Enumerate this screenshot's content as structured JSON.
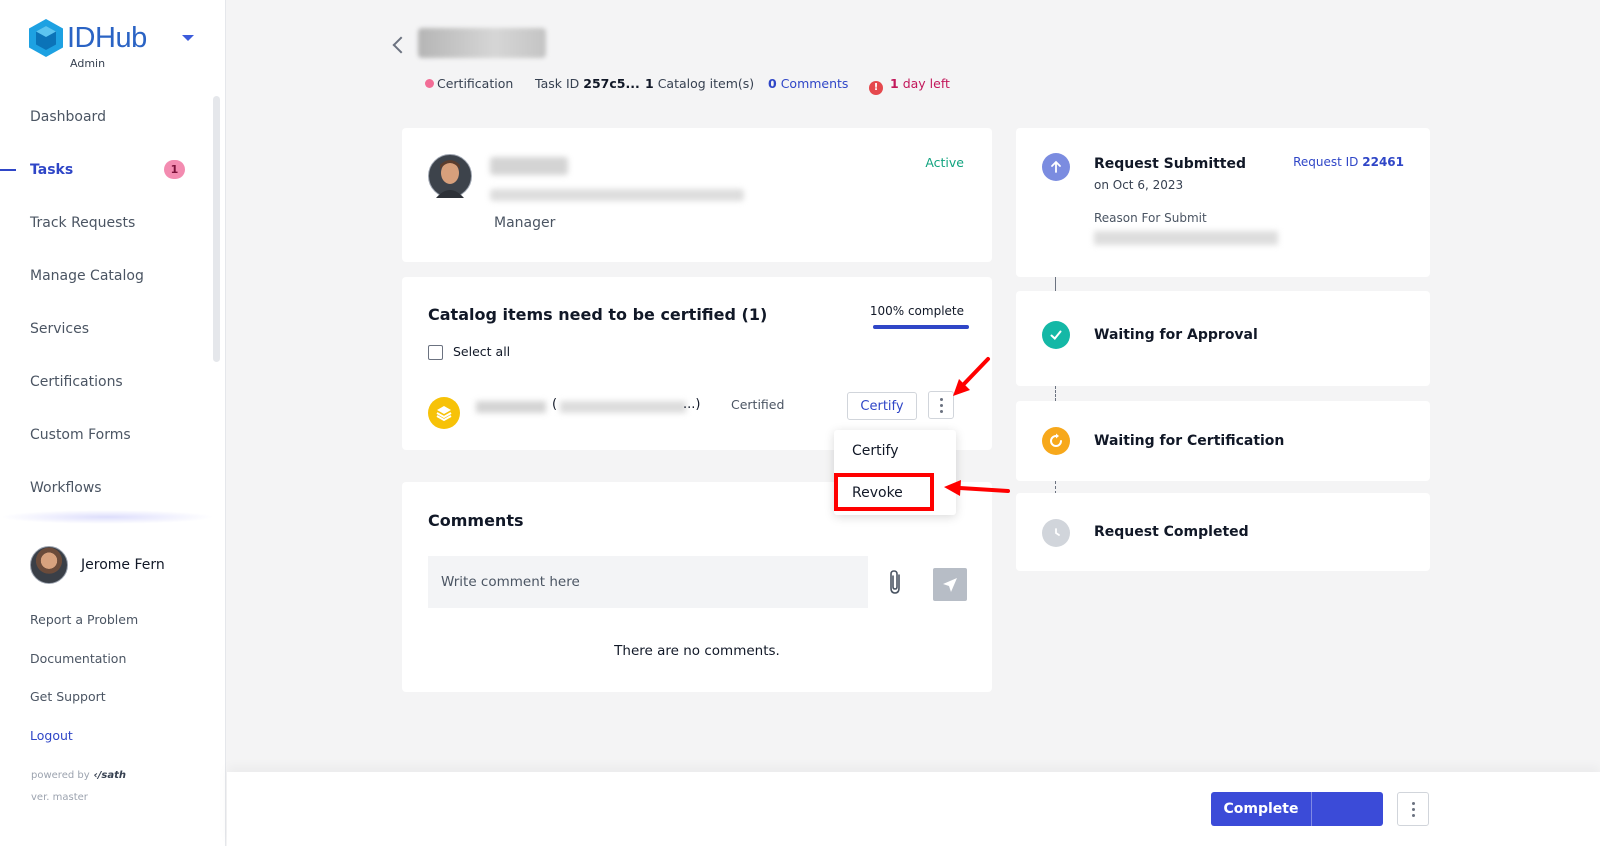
{
  "brand": {
    "name": "IDHub",
    "subtitle": "Admin"
  },
  "sidebar": {
    "items": [
      {
        "label": "Dashboard"
      },
      {
        "label": "Tasks",
        "badge": "1",
        "active": true
      },
      {
        "label": "Track Requests"
      },
      {
        "label": "Manage Catalog"
      },
      {
        "label": "Services"
      },
      {
        "label": "Certifications"
      },
      {
        "label": "Custom Forms"
      },
      {
        "label": "Workflows"
      }
    ],
    "user": {
      "name": "Jerome Fern"
    },
    "links": [
      "Report a Problem",
      "Documentation",
      "Get Support",
      "Logout"
    ],
    "powered_by": "powered by",
    "powered_brand": "‹/sath",
    "version": "ver. master"
  },
  "header": {
    "type": "Certification",
    "task_id_label": "Task ID",
    "task_id_value": "257c5...",
    "catalog_count": "1",
    "catalog_label": "Catalog item(s)",
    "comments_count": "0",
    "comments_label": "Comments",
    "alert_glyph": "!",
    "days_count": "1",
    "days_label": "day left"
  },
  "user_card": {
    "role": "Manager",
    "status": "Active"
  },
  "catalog": {
    "title": "Catalog items need to be certified (1)",
    "progress_label": "100% complete",
    "progress_percent": 100,
    "select_all": "Select all",
    "item": {
      "paren_open": "(",
      "paren_close": "...)",
      "status": "Certified",
      "certify_label": "Certify"
    },
    "dropdown": {
      "options": [
        "Certify",
        "Revoke"
      ],
      "highlighted": "Revoke"
    }
  },
  "comments": {
    "title": "Comments",
    "placeholder": "Write comment here",
    "empty": "There are no comments."
  },
  "timeline": {
    "steps": [
      {
        "title": "Request Submitted",
        "date": "on Oct 6, 2023",
        "reason_label": "Reason For Submit",
        "request_id_label": "Request ID",
        "request_id": "22461"
      },
      {
        "title": "Waiting for Approval"
      },
      {
        "title": "Waiting for Certification"
      },
      {
        "title": "Request Completed"
      }
    ]
  },
  "footer": {
    "complete_label": "Complete"
  },
  "colors": {
    "accent": "#2f46c7",
    "badge": "#f38bb0",
    "success": "#10a37f",
    "warning": "#f7a81b",
    "danger": "#e5484d",
    "annotation": "#ff0000"
  }
}
